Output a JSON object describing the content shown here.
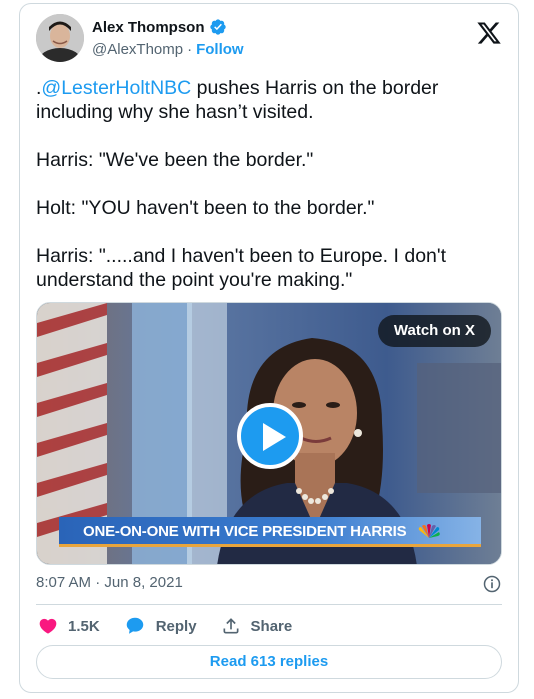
{
  "author": {
    "name": "Alex Thompson",
    "handle": "@AlexThomp",
    "separator": "·",
    "follow_label": "Follow"
  },
  "tweet": {
    "prefix": ".",
    "mention": "@LesterHoltNBC",
    "line1_rest": " pushes Harris on the border\nincluding why she hasn’t visited.",
    "para2": "Harris: \"We've been the border.\"",
    "para3": "Holt: \"YOU haven't been to the border.\"",
    "para4": "Harris: \".....and I haven't been to Europe. I don't\nunderstand the point you're making.\""
  },
  "media": {
    "watch_label": "Watch on X",
    "lower_third": "ONE-ON-ONE WITH VICE PRESIDENT HARRIS",
    "network_bug": "NBC NEWS"
  },
  "meta": {
    "time": "8:07 AM",
    "separator": "·",
    "date": "Jun 8, 2021"
  },
  "actions": {
    "likes": "1.5K",
    "reply_label": "Reply",
    "share_label": "Share"
  },
  "read_replies_label": "Read 613 replies",
  "colors": {
    "accent": "#1d9bf0",
    "like": "#f91880",
    "text": "#0f1419",
    "muted": "#536471",
    "border": "#cfd9de"
  }
}
